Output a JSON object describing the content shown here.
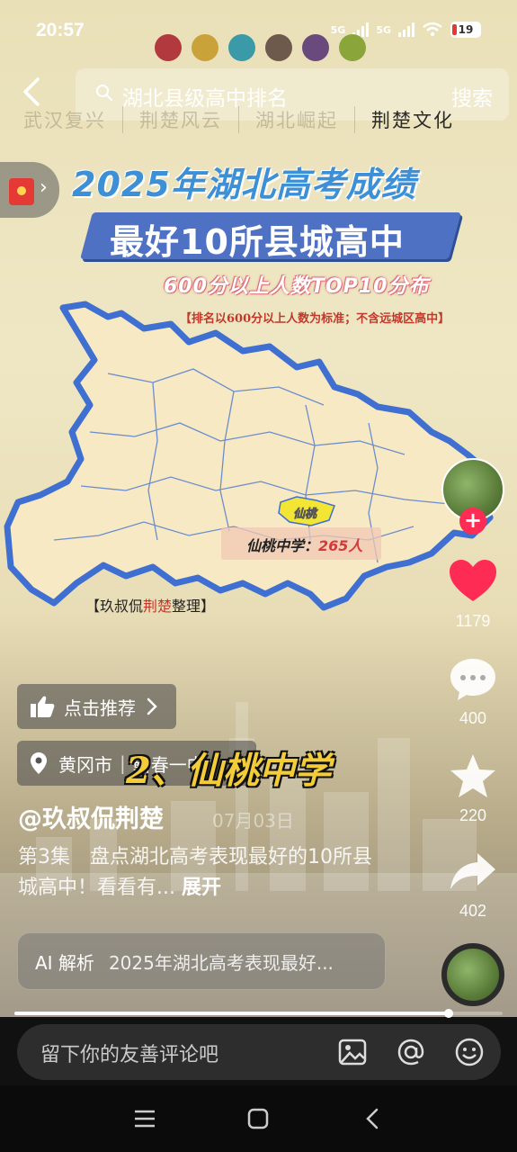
{
  "status_bar": {
    "time": "20:57",
    "signal1_label": "5G",
    "signal2_label": "5G",
    "battery": "19"
  },
  "color_dots": [
    "#b23a3f",
    "#c9a23a",
    "#3b9aa8",
    "#6d5a4c",
    "#6a4a7c",
    "#8aa63a"
  ],
  "search": {
    "query": "湖北县级高中排名",
    "button_label": "搜索"
  },
  "tabs": [
    {
      "label": "武汉复兴",
      "active": false
    },
    {
      "label": "荆楚风云",
      "active": false
    },
    {
      "label": "湖北崛起",
      "active": false
    },
    {
      "label": "荆楚文化",
      "active": true
    }
  ],
  "video": {
    "title_line1": "2025年湖北高考成绩",
    "title_line2": "最好10所县城高中",
    "subtitle": "600分以上人数TOP10分布",
    "note": "【排名以600分以上人数为标准；不含远城区高中】",
    "map_highlight_label": "仙桃",
    "map_callout_school": "仙桃中学：",
    "map_callout_count": "265人",
    "credit_prefix": "【玖叔侃",
    "credit_highlight": "荆楚",
    "credit_suffix": "整理】",
    "overlay_caption": "2、仙桃中学"
  },
  "actions": {
    "likes": "1179",
    "comments": "400",
    "favorites": "220",
    "shares": "402",
    "like_color": "#fe2c55"
  },
  "chips": {
    "recommend_label": "点击推荐",
    "location_city": "黄冈市",
    "location_place": "蕲春一中"
  },
  "post": {
    "author": "@玖叔侃荆楚",
    "date": "07月03日",
    "description": "第3集　盘点湖北高考表现最好的10所县城高中！看看有...",
    "expand_label": "展开"
  },
  "ai_bar": {
    "label": "AI 解析",
    "text": "2025年湖北高考表现最好..."
  },
  "playback": {
    "progress_percent": 89
  },
  "comment": {
    "placeholder": "留下你的友善评论吧"
  }
}
